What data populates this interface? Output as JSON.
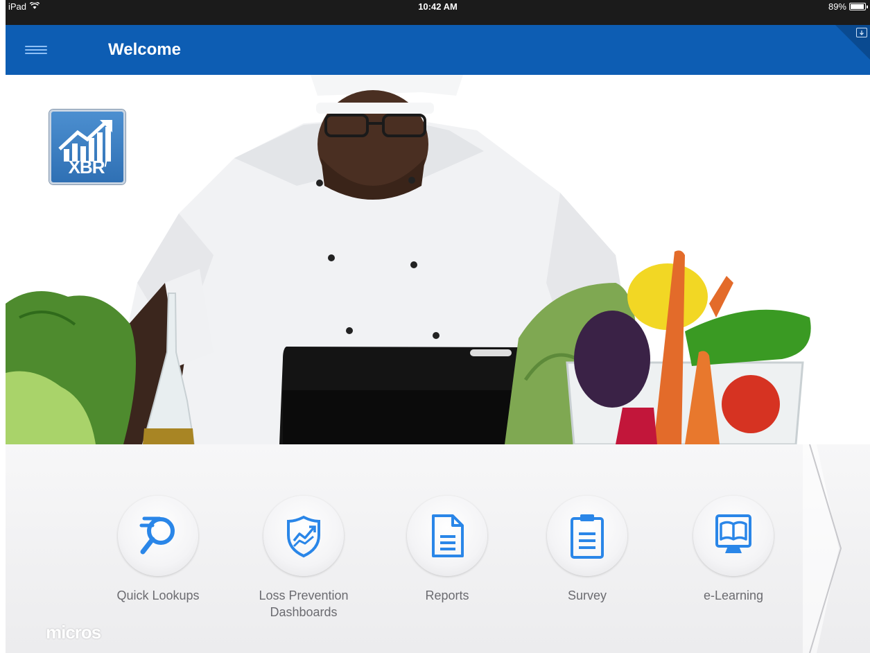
{
  "status_bar": {
    "device": "iPad",
    "time": "10:42 AM",
    "battery": "89%"
  },
  "nav": {
    "title": "Welcome"
  },
  "logo": {
    "text": "XBR",
    "superscript": "i"
  },
  "menu": [
    {
      "label_line1": "Quick Lookups",
      "label_line2": "",
      "icon": "magnifier-icon"
    },
    {
      "label_line1": "Loss Prevention",
      "label_line2": "Dashboards",
      "icon": "shield-chart-icon"
    },
    {
      "label_line1": "Reports",
      "label_line2": "",
      "icon": "document-icon"
    },
    {
      "label_line1": "Survey",
      "label_line2": "",
      "icon": "clipboard-icon"
    },
    {
      "label_line1": "e-Learning",
      "label_line2": "",
      "icon": "monitor-book-icon"
    }
  ],
  "brand": "micros",
  "colors": {
    "nav_blue": "#0d5db3",
    "icon_blue": "#2a86e8"
  }
}
